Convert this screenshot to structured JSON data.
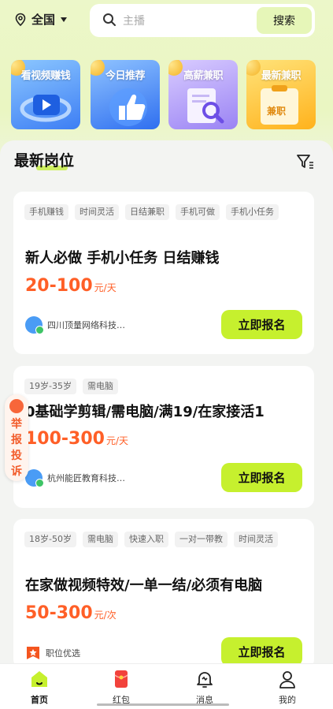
{
  "header": {
    "location": "全国",
    "search_placeholder": "主播",
    "search_button": "搜索"
  },
  "tiles": [
    {
      "label": "看视频赚钱",
      "icon": "play-video-icon"
    },
    {
      "label": "今日推荐",
      "icon": "thumbs-up-icon"
    },
    {
      "label": "高薪兼职",
      "icon": "magnifier-document-icon"
    },
    {
      "label": "最新兼职",
      "icon": "part-time-clipboard-icon",
      "sub": "兼职"
    }
  ],
  "section": {
    "title": "最新岗位"
  },
  "jobs": [
    {
      "tags": [
        "手机赚钱",
        "时间灵活",
        "日结兼职",
        "手机可做",
        "手机小任务"
      ],
      "title": "新人必做 手机小任务 日结赚钱",
      "salary": "20-100",
      "unit": "元/天",
      "company": "四川顶量网络科技…",
      "apply": "立即报名"
    },
    {
      "tags": [
        "19岁-35岁",
        "需电脑"
      ],
      "title": "0基础学剪辑/需电脑/满19/在家接活1",
      "salary": "100-300",
      "unit": "元/天",
      "company": "杭州能匠教育科技…",
      "apply": "立即报名"
    },
    {
      "tags": [
        "18岁-50岁",
        "需电脑",
        "快速入职",
        "一对一带教",
        "时间灵活"
      ],
      "title": "在家做视频特效/一单一结/必须有电脑",
      "salary": "50-300",
      "unit": "元/次",
      "company": "职位优选",
      "apply": "立即报名"
    }
  ],
  "report": {
    "label": "举报投诉"
  },
  "tabbar": [
    {
      "label": "首页",
      "icon": "home-icon",
      "active": true
    },
    {
      "label": "红包",
      "icon": "red-envelope-icon"
    },
    {
      "label": "消息",
      "icon": "bell-message-icon"
    },
    {
      "label": "我的",
      "icon": "user-icon"
    }
  ],
  "colors": {
    "accent": "#c6f02e",
    "salary": "#ff5f27",
    "report": "#f25c2b"
  }
}
